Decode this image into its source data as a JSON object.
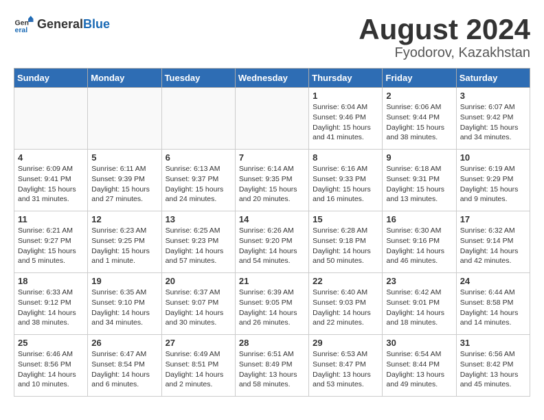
{
  "logo": {
    "general": "General",
    "blue": "Blue"
  },
  "title": {
    "month": "August 2024",
    "location": "Fyodorov, Kazakhstan"
  },
  "weekdays": [
    "Sunday",
    "Monday",
    "Tuesday",
    "Wednesday",
    "Thursday",
    "Friday",
    "Saturday"
  ],
  "weeks": [
    [
      {
        "day": null
      },
      {
        "day": null
      },
      {
        "day": null
      },
      {
        "day": null
      },
      {
        "day": 1,
        "sunrise": "Sunrise: 6:04 AM",
        "sunset": "Sunset: 9:46 PM",
        "daylight": "Daylight: 15 hours and 41 minutes."
      },
      {
        "day": 2,
        "sunrise": "Sunrise: 6:06 AM",
        "sunset": "Sunset: 9:44 PM",
        "daylight": "Daylight: 15 hours and 38 minutes."
      },
      {
        "day": 3,
        "sunrise": "Sunrise: 6:07 AM",
        "sunset": "Sunset: 9:42 PM",
        "daylight": "Daylight: 15 hours and 34 minutes."
      }
    ],
    [
      {
        "day": 4,
        "sunrise": "Sunrise: 6:09 AM",
        "sunset": "Sunset: 9:41 PM",
        "daylight": "Daylight: 15 hours and 31 minutes."
      },
      {
        "day": 5,
        "sunrise": "Sunrise: 6:11 AM",
        "sunset": "Sunset: 9:39 PM",
        "daylight": "Daylight: 15 hours and 27 minutes."
      },
      {
        "day": 6,
        "sunrise": "Sunrise: 6:13 AM",
        "sunset": "Sunset: 9:37 PM",
        "daylight": "Daylight: 15 hours and 24 minutes."
      },
      {
        "day": 7,
        "sunrise": "Sunrise: 6:14 AM",
        "sunset": "Sunset: 9:35 PM",
        "daylight": "Daylight: 15 hours and 20 minutes."
      },
      {
        "day": 8,
        "sunrise": "Sunrise: 6:16 AM",
        "sunset": "Sunset: 9:33 PM",
        "daylight": "Daylight: 15 hours and 16 minutes."
      },
      {
        "day": 9,
        "sunrise": "Sunrise: 6:18 AM",
        "sunset": "Sunset: 9:31 PM",
        "daylight": "Daylight: 15 hours and 13 minutes."
      },
      {
        "day": 10,
        "sunrise": "Sunrise: 6:19 AM",
        "sunset": "Sunset: 9:29 PM",
        "daylight": "Daylight: 15 hours and 9 minutes."
      }
    ],
    [
      {
        "day": 11,
        "sunrise": "Sunrise: 6:21 AM",
        "sunset": "Sunset: 9:27 PM",
        "daylight": "Daylight: 15 hours and 5 minutes."
      },
      {
        "day": 12,
        "sunrise": "Sunrise: 6:23 AM",
        "sunset": "Sunset: 9:25 PM",
        "daylight": "Daylight: 15 hours and 1 minute."
      },
      {
        "day": 13,
        "sunrise": "Sunrise: 6:25 AM",
        "sunset": "Sunset: 9:23 PM",
        "daylight": "Daylight: 14 hours and 57 minutes."
      },
      {
        "day": 14,
        "sunrise": "Sunrise: 6:26 AM",
        "sunset": "Sunset: 9:20 PM",
        "daylight": "Daylight: 14 hours and 54 minutes."
      },
      {
        "day": 15,
        "sunrise": "Sunrise: 6:28 AM",
        "sunset": "Sunset: 9:18 PM",
        "daylight": "Daylight: 14 hours and 50 minutes."
      },
      {
        "day": 16,
        "sunrise": "Sunrise: 6:30 AM",
        "sunset": "Sunset: 9:16 PM",
        "daylight": "Daylight: 14 hours and 46 minutes."
      },
      {
        "day": 17,
        "sunrise": "Sunrise: 6:32 AM",
        "sunset": "Sunset: 9:14 PM",
        "daylight": "Daylight: 14 hours and 42 minutes."
      }
    ],
    [
      {
        "day": 18,
        "sunrise": "Sunrise: 6:33 AM",
        "sunset": "Sunset: 9:12 PM",
        "daylight": "Daylight: 14 hours and 38 minutes."
      },
      {
        "day": 19,
        "sunrise": "Sunrise: 6:35 AM",
        "sunset": "Sunset: 9:10 PM",
        "daylight": "Daylight: 14 hours and 34 minutes."
      },
      {
        "day": 20,
        "sunrise": "Sunrise: 6:37 AM",
        "sunset": "Sunset: 9:07 PM",
        "daylight": "Daylight: 14 hours and 30 minutes."
      },
      {
        "day": 21,
        "sunrise": "Sunrise: 6:39 AM",
        "sunset": "Sunset: 9:05 PM",
        "daylight": "Daylight: 14 hours and 26 minutes."
      },
      {
        "day": 22,
        "sunrise": "Sunrise: 6:40 AM",
        "sunset": "Sunset: 9:03 PM",
        "daylight": "Daylight: 14 hours and 22 minutes."
      },
      {
        "day": 23,
        "sunrise": "Sunrise: 6:42 AM",
        "sunset": "Sunset: 9:01 PM",
        "daylight": "Daylight: 14 hours and 18 minutes."
      },
      {
        "day": 24,
        "sunrise": "Sunrise: 6:44 AM",
        "sunset": "Sunset: 8:58 PM",
        "daylight": "Daylight: 14 hours and 14 minutes."
      }
    ],
    [
      {
        "day": 25,
        "sunrise": "Sunrise: 6:46 AM",
        "sunset": "Sunset: 8:56 PM",
        "daylight": "Daylight: 14 hours and 10 minutes."
      },
      {
        "day": 26,
        "sunrise": "Sunrise: 6:47 AM",
        "sunset": "Sunset: 8:54 PM",
        "daylight": "Daylight: 14 hours and 6 minutes."
      },
      {
        "day": 27,
        "sunrise": "Sunrise: 6:49 AM",
        "sunset": "Sunset: 8:51 PM",
        "daylight": "Daylight: 14 hours and 2 minutes."
      },
      {
        "day": 28,
        "sunrise": "Sunrise: 6:51 AM",
        "sunset": "Sunset: 8:49 PM",
        "daylight": "Daylight: 13 hours and 58 minutes."
      },
      {
        "day": 29,
        "sunrise": "Sunrise: 6:53 AM",
        "sunset": "Sunset: 8:47 PM",
        "daylight": "Daylight: 13 hours and 53 minutes."
      },
      {
        "day": 30,
        "sunrise": "Sunrise: 6:54 AM",
        "sunset": "Sunset: 8:44 PM",
        "daylight": "Daylight: 13 hours and 49 minutes."
      },
      {
        "day": 31,
        "sunrise": "Sunrise: 6:56 AM",
        "sunset": "Sunset: 8:42 PM",
        "daylight": "Daylight: 13 hours and 45 minutes."
      }
    ]
  ]
}
